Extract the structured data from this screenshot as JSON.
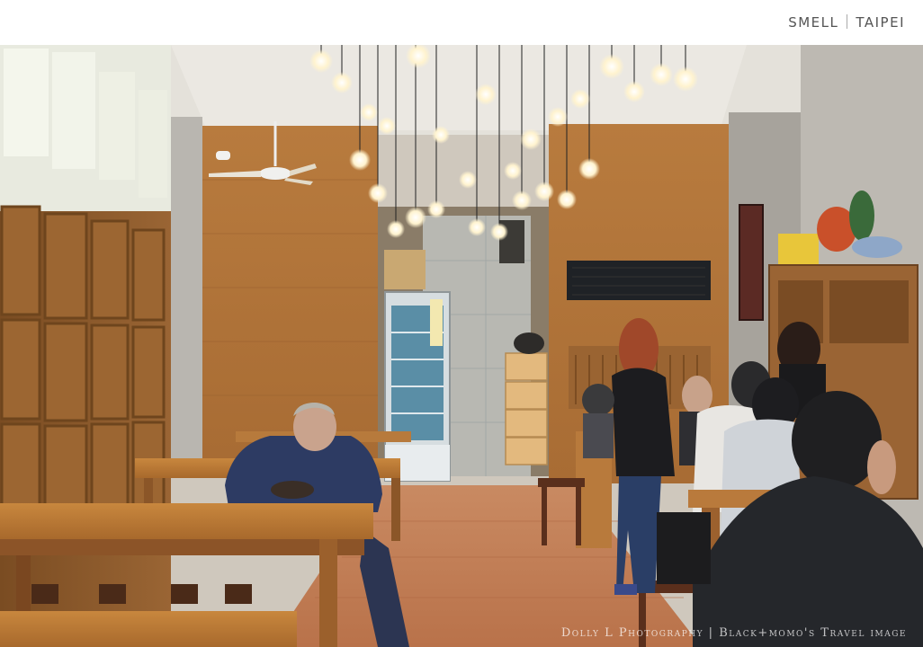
{
  "header": {
    "left_label": "SMELL",
    "right_label": "TAIPEI"
  },
  "photo": {
    "description_icon": "restaurant-interior-photo",
    "watermark": "Dolly L Photography | Black+momo's Travel image"
  },
  "colors": {
    "wood": "#b0733a",
    "wall_left": "#8a5a2b",
    "floor": "#c8825a",
    "ceiling": "#e6e3dc",
    "bulb": "#fff7e0"
  }
}
